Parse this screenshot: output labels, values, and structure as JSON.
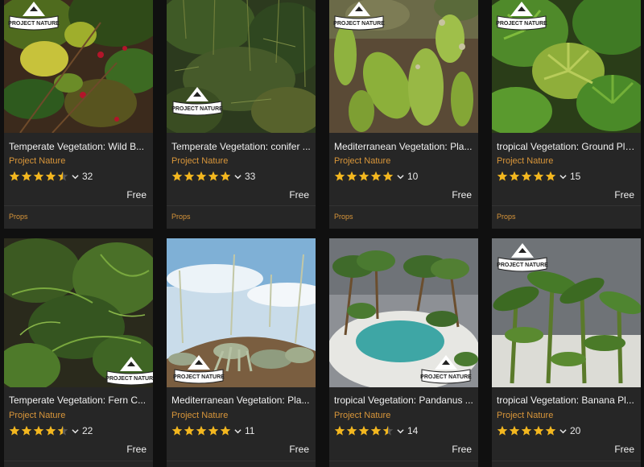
{
  "colors": {
    "card_background": "#262626",
    "page_background": "#101010",
    "accent": "#d9963a",
    "star": "#f3b71f",
    "text": "#f1f1f1"
  },
  "badge_text": "PROJECT NATURE",
  "cards": [
    {
      "title": "Temperate Vegetation: Wild B...",
      "publisher": "Project Nature",
      "rating": 4.5,
      "rating_count": "32",
      "price": "Free",
      "category": "Props",
      "thumbnail": "wild-berry-bush-thumbnail"
    },
    {
      "title": "Temperate Vegetation: conifer ...",
      "publisher": "Project Nature",
      "rating": 5,
      "rating_count": "33",
      "price": "Free",
      "category": "Props",
      "thumbnail": "conifer-forest-thumbnail"
    },
    {
      "title": "Mediterranean Vegetation: Pla...",
      "publisher": "Project Nature",
      "rating": 5,
      "rating_count": "10",
      "price": "Free",
      "category": "Props",
      "thumbnail": "prickly-pear-cactus-thumbnail"
    },
    {
      "title": "tropical Vegetation: Ground Pla...",
      "publisher": "Project Nature",
      "rating": 5,
      "rating_count": "15",
      "price": "Free",
      "category": "Props",
      "thumbnail": "tropical-ground-plants-thumbnail"
    },
    {
      "title": "Temperate Vegetation: Fern C...",
      "publisher": "Project Nature",
      "rating": 4.5,
      "rating_count": "22",
      "price": "Free",
      "thumbnail": "fern-collection-thumbnail"
    },
    {
      "title": "Mediterranean Vegetation: Pla...",
      "publisher": "Project Nature",
      "rating": 5,
      "rating_count": "11",
      "price": "Free",
      "thumbnail": "agave-plants-thumbnail"
    },
    {
      "title": "tropical Vegetation: Pandanus ...",
      "publisher": "Project Nature",
      "rating": 4.5,
      "rating_count": "14",
      "price": "Free",
      "thumbnail": "pandanus-island-thumbnail"
    },
    {
      "title": "tropical Vegetation: Banana Pl...",
      "publisher": "Project Nature",
      "rating": 5,
      "rating_count": "20",
      "price": "Free",
      "thumbnail": "banana-plants-thumbnail"
    }
  ]
}
